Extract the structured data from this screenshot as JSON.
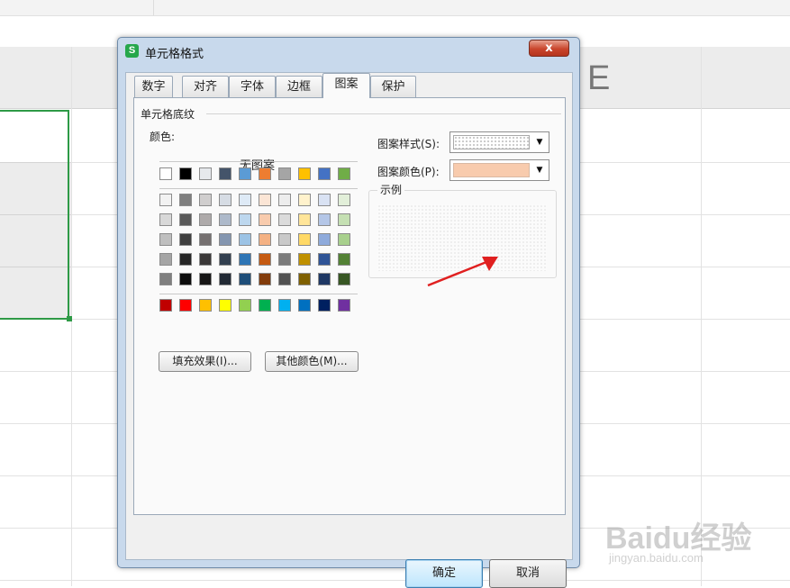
{
  "spreadsheet": {
    "column_header_letter": "E"
  },
  "dialog": {
    "title": "单元格格式",
    "app_icon": "S",
    "close_icon": "x",
    "tabs": [
      "数字",
      "对齐",
      "字体",
      "边框",
      "图案",
      "保护"
    ],
    "active_tab": "图案",
    "group_title": "单元格底纹",
    "color_label": "颜色:",
    "no_pattern_label": "无图案",
    "palette": {
      "row1": [
        "#ffffff",
        "#000000",
        "#e6e9ec",
        "#44546a",
        "#5b9bd5",
        "#ed7d31",
        "#a5a5a5",
        "#ffc000",
        "#4472c4",
        "#70ad47"
      ],
      "row2": [
        "#f2f2f2",
        "#7f7f7f",
        "#d0cece",
        "#d6dce4",
        "#deeaf6",
        "#fbe5d5",
        "#ededed",
        "#fff2cc",
        "#d9e2f3",
        "#e2efd9"
      ],
      "row3": [
        "#d8d8d8",
        "#595959",
        "#aeaaaa",
        "#adb9ca",
        "#bdd7ee",
        "#f8cbad",
        "#dbdbdb",
        "#ffe599",
        "#b4c6e7",
        "#c5e0b3"
      ],
      "row4": [
        "#bfbfbf",
        "#3f3f3f",
        "#757070",
        "#8496b0",
        "#9cc3e5",
        "#f4b183",
        "#c9c9c9",
        "#ffd966",
        "#8eaadb",
        "#a8d08d"
      ],
      "row5": [
        "#a5a5a5",
        "#262626",
        "#3a3838",
        "#323f4f",
        "#2e75b5",
        "#c55a11",
        "#7b7b7b",
        "#bf9000",
        "#2f5496",
        "#538135"
      ],
      "row6": [
        "#7f7f7f",
        "#0d0d0d",
        "#171616",
        "#222a35",
        "#1e4e79",
        "#833c0b",
        "#525252",
        "#7f6000",
        "#1f3864",
        "#375623"
      ],
      "standard": [
        "#c00000",
        "#ff0000",
        "#ffc000",
        "#ffff00",
        "#92d050",
        "#00b050",
        "#00b0f0",
        "#0070c0",
        "#002060",
        "#7030a0"
      ]
    },
    "fill_effects_button": "填充效果(I)...",
    "more_colors_button": "其他颜色(M)...",
    "pattern_style_label": "图案样式(S):",
    "pattern_color_label": "图案颜色(P):",
    "pattern_color_value": "#f8cbad",
    "sample_label": "示例",
    "ok_button": "确定",
    "cancel_button": "取消",
    "dropdown_icon": "▼"
  },
  "colors": {
    "selection_border": "#2e9a46",
    "annotation_arrow": "#e02020"
  },
  "watermark": {
    "brand": "Baidu经验",
    "url": "jingyan.baidu.com"
  }
}
